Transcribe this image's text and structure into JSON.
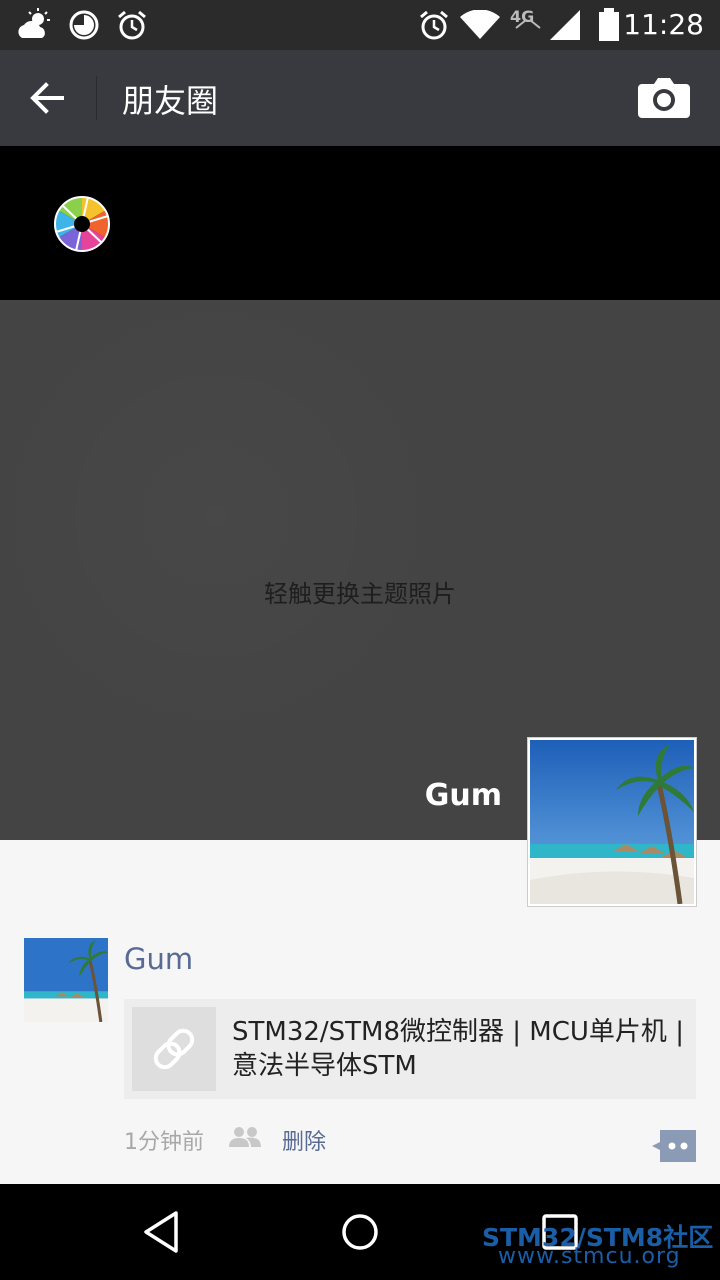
{
  "status_bar": {
    "time": "11:28",
    "network": "4G",
    "icons": [
      "weather-icon",
      "data-saver-icon",
      "alarm-icon",
      "alarm-icon",
      "wifi-icon",
      "signal-icon",
      "battery-icon"
    ]
  },
  "header": {
    "title": "朋友圈",
    "back_icon": "back-arrow-icon",
    "camera_icon": "camera-icon"
  },
  "cover": {
    "hint": "轻触更换主题照片",
    "username": "Gum"
  },
  "post": {
    "username": "Gum",
    "link_title": "STM32/STM8微控制器 | MCU单片机 | 意法半导体STM",
    "time": "1分钟前",
    "delete_label": "删除"
  },
  "watermark": {
    "title": "STM32/STM8社区",
    "url": "www.stmcu.org"
  },
  "colors": {
    "action_bar": "#393a3f",
    "link_blue": "#576b95",
    "cover": "#444444"
  }
}
